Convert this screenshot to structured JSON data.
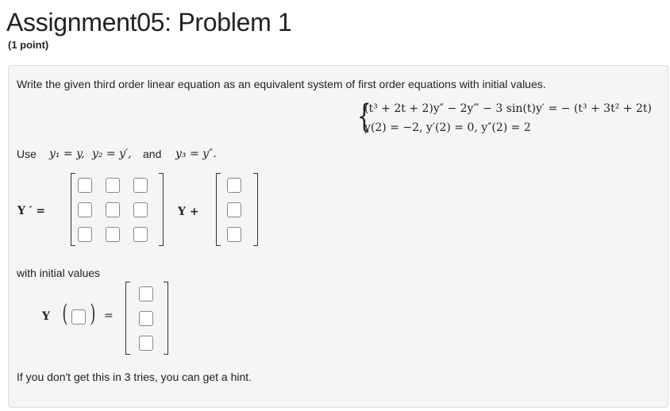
{
  "header": {
    "title": "Assignment05: Problem 1",
    "points": "(1 point)"
  },
  "problem": {
    "instruction": "Write the given third order linear equation as an equivalent system of first order equations with initial values.",
    "equation_line1": "(t³ + 2t + 2)y″ − 2y‴ − 3 sin(t)y′ = − (t³ + 3t² + 2t)",
    "equation_line2": "y(2) = −2,   y′(2) = 0,   y″(2) = 2",
    "use_label": "Use",
    "sub1": "y₁ = y,",
    "sub2": "y₂ = y′,",
    "and_label": "and",
    "sub3": "y₃ = y″.",
    "lhs_label": "Y ′ =",
    "y_plus_label": "Y +",
    "initial_values_label": "with initial values",
    "y_label": "Y",
    "equals": "=",
    "hint": "If you don't get this in 3 tries, you can get a hint."
  }
}
